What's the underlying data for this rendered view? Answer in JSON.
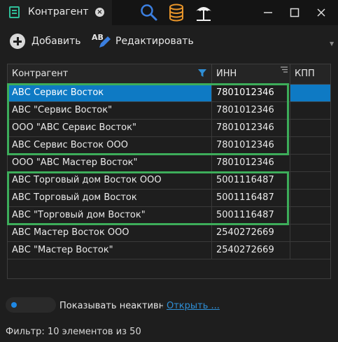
{
  "window": {
    "tab_title": "Контрагент",
    "tab_close_icon": "close-icon",
    "toolbar_icons": [
      "search-icon",
      "database-icon",
      "beach-umbrella-icon"
    ],
    "window_buttons": [
      "minimize-icon",
      "maximize-icon",
      "close-icon"
    ]
  },
  "toolbar": {
    "add_label": "Добавить",
    "edit_icon_text": "AB",
    "edit_label": "Редактировать"
  },
  "grid": {
    "columns": [
      "Контрагент",
      "ИНН",
      "КПП"
    ],
    "filter_icon": "filter-icon",
    "sort_icon": "sort-lines-icon",
    "rows": [
      {
        "name": "АВС Сервис Восток",
        "inn": "7801012346",
        "kpp": "",
        "selected": true
      },
      {
        "name": "АВС \"Сервис Восток\"",
        "inn": "7801012346",
        "kpp": ""
      },
      {
        "name": "ООО \"АВС Сервис Восток\"",
        "inn": "7801012346",
        "kpp": ""
      },
      {
        "name": "АВС Сервис Восток ООО",
        "inn": "7801012346",
        "kpp": ""
      },
      {
        "name": "ООО \"АВС Мастер Восток\"",
        "inn": "7801012346",
        "kpp": ""
      },
      {
        "name": "АВС Торговый дом Восток ООО",
        "inn": "5001116487",
        "kpp": ""
      },
      {
        "name": "АВС Торговый дом Восток",
        "inn": "5001116487",
        "kpp": ""
      },
      {
        "name": "АВС \"Торговый дом Восток\"",
        "inn": "5001116487",
        "kpp": ""
      },
      {
        "name": "АВС Мастер Восток ООО",
        "inn": "2540272669",
        "kpp": ""
      },
      {
        "name": "АВС \"Мастер Восток\"",
        "inn": "2540272669",
        "kpp": ""
      }
    ],
    "highlight_color": "#3dad5a",
    "selection_color": "#0e7ac4"
  },
  "footer": {
    "toggle_label": "Показывать неактивные",
    "open_link": "Открыть ...",
    "filter_status": "Фильтр: 10 элементов из 50"
  }
}
